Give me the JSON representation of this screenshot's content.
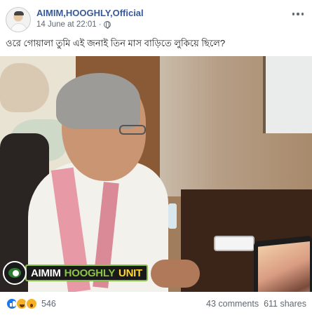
{
  "post": {
    "page_name": "AIMIM,HOOGHLY,Official",
    "timestamp": "14 June at 22:01",
    "separator": "·",
    "caption": "ওরে গোয়ালা তুমি এই জনাই তিন মাস বাড়িতে লুকিয়ে ছিলে?",
    "image_watermark": {
      "part1": "AIMIM",
      "part2": "HOOGHLY",
      "part3": "UNIT"
    }
  },
  "footer": {
    "reaction_count": "546",
    "comments": "43 comments",
    "shares": "611 shares",
    "reaction_icons": [
      "like-icon",
      "haha-icon",
      "wow-icon"
    ]
  },
  "colors": {
    "link": "#385898",
    "like": "#1877f2",
    "emoji": "#f7b125",
    "watermark_green": "#8bc34a",
    "watermark_yellow": "#fdd835"
  }
}
